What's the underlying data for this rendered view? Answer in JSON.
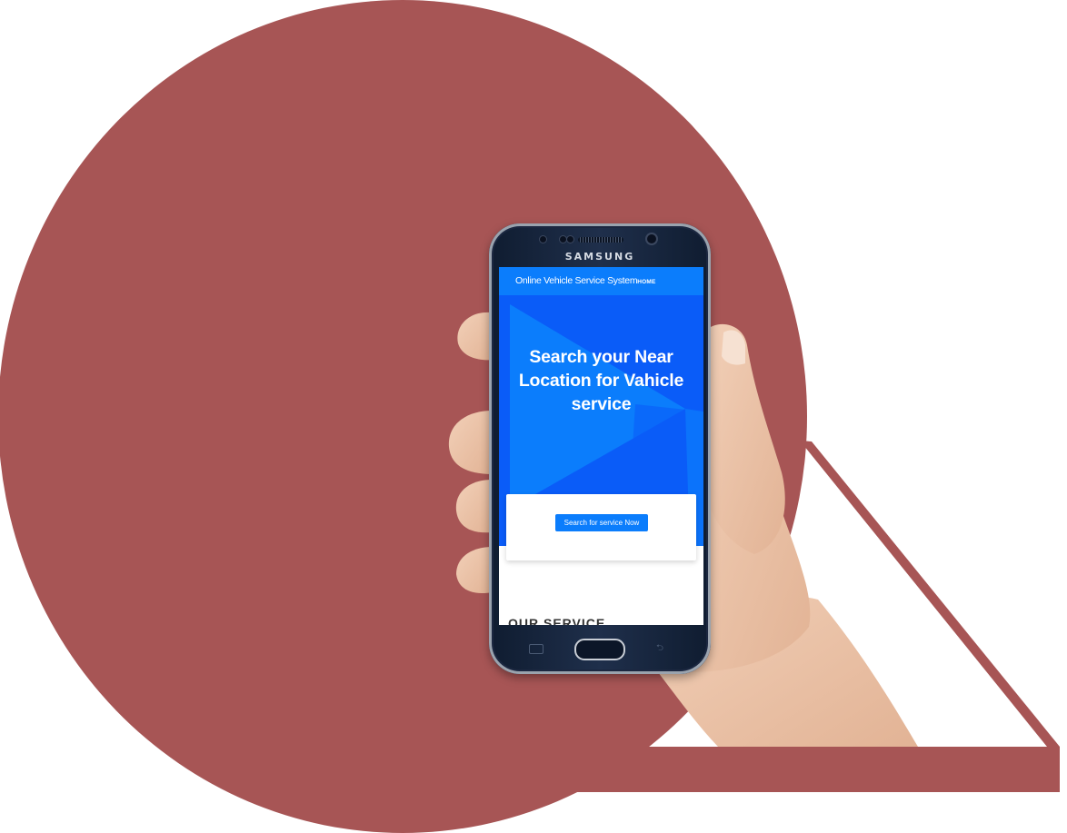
{
  "colors": {
    "decor": "#a75555",
    "navbar": "#0b7dfc",
    "hero": "#0a5cf8",
    "button": "#0b7dfc"
  },
  "phone": {
    "brand": "SAMSUNG"
  },
  "app": {
    "brand": "Online Vehicle Service System",
    "nav_home": "HOME",
    "hero_title": "Search your Near Location for Vahicle service",
    "search_button": "Search for service Now",
    "section_heading": "OUR SERVICE"
  },
  "icons": {
    "home_key": "home-button-icon",
    "recent_apps": "recent-apps-icon",
    "back": "back-icon"
  }
}
